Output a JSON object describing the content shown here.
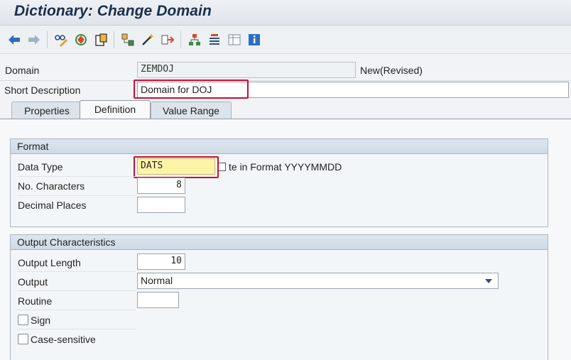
{
  "window": {
    "title": "Dictionary: Change Domain"
  },
  "toolbar": {
    "icons": [
      "back-arrow-icon",
      "forward-arrow-icon",
      "glasses-pencil-icon",
      "activate-icon",
      "clipboard-icon",
      "object-list-icon",
      "magic-wand-icon",
      "where-used-icon",
      "hierarchy-icon",
      "list-align-icon",
      "table-icon",
      "info-icon"
    ]
  },
  "header": {
    "domain_label": "Domain",
    "domain_value": "ZEMDOJ",
    "domain_status": "New(Revised)",
    "short_desc_label": "Short Description",
    "short_desc_value": "Domain for DOJ"
  },
  "tabs": [
    {
      "label": "Properties",
      "active": false
    },
    {
      "label": "Definition",
      "active": true
    },
    {
      "label": "Value Range",
      "active": false
    }
  ],
  "format": {
    "title": "Format",
    "data_type_label": "Data Type",
    "data_type_value": "DATS",
    "data_type_desc": "te in Format YYYYMMDD",
    "no_chars_label": "No. Characters",
    "no_chars_value": "8",
    "decimal_label": "Decimal Places",
    "decimal_value": ""
  },
  "output": {
    "title": "Output Characteristics",
    "length_label": "Output Length",
    "length_value": "10",
    "output_label": "Output",
    "output_value": "Normal",
    "routine_label": "Routine",
    "routine_value": "",
    "sign_label": "Sign",
    "case_label": "Case-sensitive"
  },
  "colors": {
    "highlight": "#c8102e",
    "title": "#1a2f4a",
    "input_yellow": "#fff3a6"
  }
}
